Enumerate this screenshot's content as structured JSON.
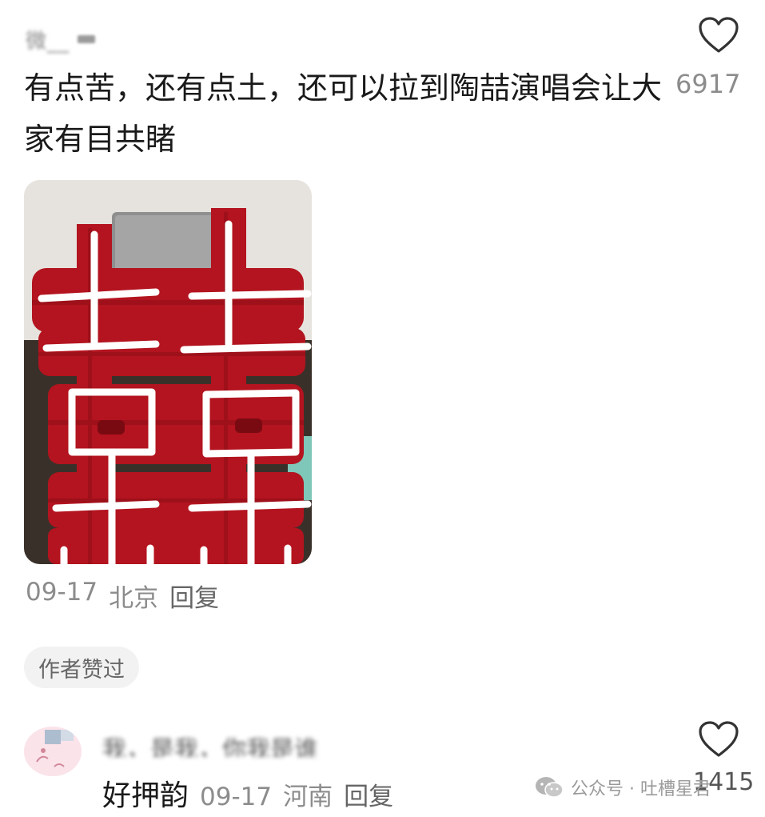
{
  "comment1": {
    "username_text": "微__",
    "text": "有点苦，还有点土，还可以拉到陶喆演唱会让大家有目共睹",
    "likes": "6917",
    "photo": {
      "icon": "red-double-happiness-fabric-sign",
      "colors": {
        "fabric": "#b3141f",
        "wall": "#e6e3de",
        "strokes": "#ffffff"
      }
    },
    "date": "09-17",
    "location": "北京",
    "reply_label": "回复",
    "author_liked_label": "作者赞过"
  },
  "comment2": {
    "username_text": "我，是我，你我是谁",
    "text": "好押韵",
    "date": "09-17",
    "location": "河南",
    "reply_label": "回复",
    "likes": "1415"
  },
  "watermark": {
    "icon": "wechat-icon",
    "label": "公众号 · 吐槽星君"
  },
  "colors": {
    "text_primary": "#1a1a1a",
    "text_secondary": "#8c8c8c",
    "badge_bg": "#f2f2f2"
  }
}
